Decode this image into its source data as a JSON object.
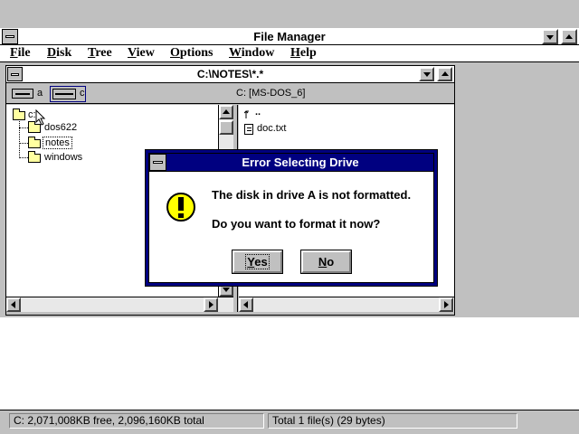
{
  "app": {
    "title": "File Manager",
    "menu": [
      {
        "label": "File",
        "u": "F",
        "rest": "ile"
      },
      {
        "label": "Disk",
        "u": "D",
        "rest": "isk"
      },
      {
        "label": "Tree",
        "u": "T",
        "rest": "ree"
      },
      {
        "label": "View",
        "u": "V",
        "rest": "iew"
      },
      {
        "label": "Options",
        "u": "O",
        "rest": "ptions"
      },
      {
        "label": "Window",
        "u": "W",
        "rest": "indow"
      },
      {
        "label": "Help",
        "u": "H",
        "rest": "elp"
      }
    ]
  },
  "dir_window": {
    "title": "C:\\NOTES\\*.*",
    "drives": [
      {
        "letter": "a"
      },
      {
        "letter": "c"
      }
    ],
    "volume_label": "C: [MS-DOS_6]",
    "tree": [
      {
        "label": "c:\\"
      },
      {
        "label": "dos622"
      },
      {
        "label": "notes"
      },
      {
        "label": "windows"
      }
    ],
    "files": [
      {
        "name": ".."
      },
      {
        "name": "doc.txt"
      }
    ]
  },
  "dialog": {
    "title": "Error Selecting Drive",
    "message_line1": "The disk in drive A is not formatted.",
    "message_line2": "Do you want to format it now?",
    "yes_u": "Y",
    "yes_rest": "es",
    "no_u": "N",
    "no_rest": "o"
  },
  "status": {
    "left": "C: 2,071,008KB free,  2,096,160KB total",
    "right": "Total 1 file(s) (29 bytes)"
  },
  "colors": {
    "active_title": "#000080",
    "face": "#c0c0c0",
    "folder": "#ffffa0"
  }
}
